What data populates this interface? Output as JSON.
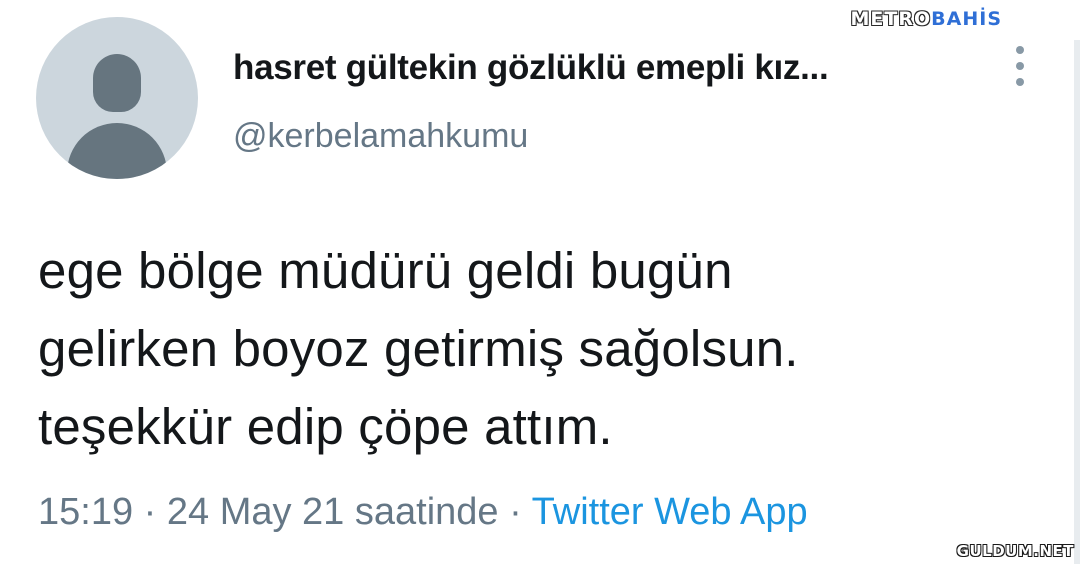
{
  "watermark": {
    "brand_part1": "METRO",
    "brand_part2": "BAHİS",
    "footer": "GULDUM.NET"
  },
  "user": {
    "display_name": "hasret gültekin gözlüklü emepli kız...",
    "handle": "@kerbelamahkumu"
  },
  "tweet": {
    "lines": [
      "ege bölge müdürü geldi bugün",
      "gelirken boyoz getirmiş sağolsun.",
      "teşekkür edip çöpe attım."
    ],
    "time": "15:19",
    "separator": " · ",
    "date": "24 May 21 saatinde",
    "source": "Twitter Web App"
  },
  "icons": {
    "avatar": "default-profile-icon",
    "menu": "more-vertical-icon"
  },
  "colors": {
    "text": "#14171a",
    "secondary": "#657786",
    "link": "#1b95e0",
    "avatar_bg": "#ccd6dd",
    "avatar_fg": "#66757f"
  }
}
